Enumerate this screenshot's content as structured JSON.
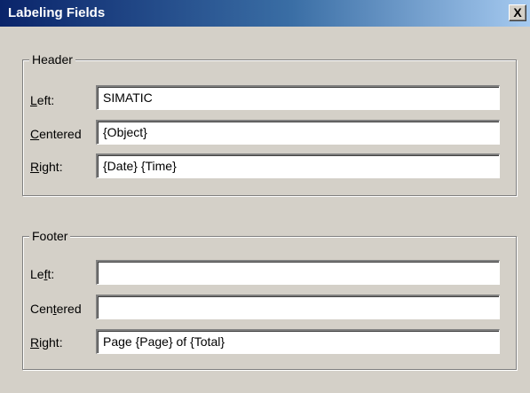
{
  "window": {
    "title": "Labeling Fields",
    "close_glyph": "X"
  },
  "header": {
    "legend": "Header",
    "rows": [
      {
        "label_accel": "L",
        "label_rest": "eft:",
        "value": "SIMATIC"
      },
      {
        "label_accel": "C",
        "label_rest": "entered",
        "value": "{Object}"
      },
      {
        "label_accel": "R",
        "label_rest": "ight:",
        "value": "{Date} {Time}"
      }
    ]
  },
  "footer": {
    "legend": "Footer",
    "rows": [
      {
        "label_pre": "Le",
        "label_accel": "f",
        "label_rest": "t:",
        "value": ""
      },
      {
        "label_pre": "Cen",
        "label_accel": "t",
        "label_rest": "ered",
        "value": ""
      },
      {
        "label_pre": "",
        "label_accel": "R",
        "label_rest": "ight:",
        "value": "Page {Page} of {Total}"
      }
    ]
  }
}
